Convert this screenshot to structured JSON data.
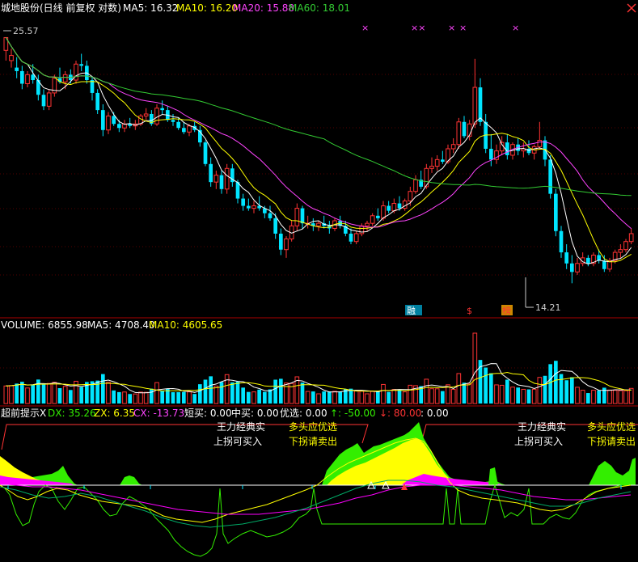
{
  "colors": {
    "up": "#ff3333",
    "down": "#00e5ff",
    "ma5": "#ffffff",
    "ma10": "#ffff00",
    "ma20": "#ff44ff",
    "ma60": "#33cc33",
    "red_line": "#aa0000",
    "label_white": "#ffffff",
    "label_gray": "#c0c0c0",
    "yellow_fill": "#ffff00",
    "green_fill": "#33ee00",
    "magenta_fill": "#ff00ff"
  },
  "header": {
    "stock_title": "城地股份(日线 前复权 对数)",
    "ma5_label": "MA5: 16.32",
    "ma10_label": "MA10: 16.20",
    "ma20_label": "MA20: 15.88",
    "ma60_label": "MA60: 18.01"
  },
  "price_pane": {
    "high_label": "25.57",
    "low_label": "14.21",
    "markers": [
      "×",
      "××",
      "×",
      "×",
      "×"
    ],
    "tags": [
      "融",
      "$",
      "榜"
    ]
  },
  "volume_pane": {
    "volume_label": "VOLUME: 6855.98",
    "ma5_label": "MA5: 4708.40",
    "ma10_label": "MA10: 4605.65"
  },
  "indicator_pane": {
    "name": "超前提示X",
    "dx": "DX: 35.26",
    "zx": "ZX: 6.35",
    "cx": "CX: -13.73",
    "short_buy": "短买: 0.00",
    "mid_buy": "中买: 0.00",
    "select": "优选: 0.00",
    "up_arrow": "↑: -50.00",
    "down_arrow": "↓: 80.00",
    "colon_val": ": 0.00",
    "left_labels": {
      "main_force": "王力经典实",
      "turn_buy": "上拐可买入",
      "bull": "多头应优选",
      "turn_sell": "下拐请卖出"
    },
    "right_labels": {
      "main_force": "王力经典实",
      "turn_buy": "上拐可买入",
      "bull": "多头应优选",
      "turn_sell": "下拐请卖出"
    }
  },
  "chart_data": {
    "type": "candlestick",
    "title": "城地股份(日线 前复权 对数)",
    "price_range": [
      14.0,
      26.5
    ],
    "candles": [
      [
        24.8,
        25.3,
        24.2,
        25.57
      ],
      [
        24.2,
        24.9,
        23.8,
        24.5
      ],
      [
        23.8,
        24.4,
        23.2,
        23.6
      ],
      [
        23.6,
        23.9,
        22.6,
        22.9
      ],
      [
        22.9,
        23.6,
        22.7,
        23.4
      ],
      [
        23.4,
        24.0,
        22.9,
        23.1
      ],
      [
        23.1,
        23.4,
        22.0,
        22.3
      ],
      [
        22.3,
        22.6,
        21.5,
        21.7
      ],
      [
        21.7,
        22.6,
        21.5,
        22.4
      ],
      [
        22.4,
        23.4,
        22.2,
        23.2
      ],
      [
        23.2,
        23.8,
        22.9,
        23.0
      ],
      [
        23.0,
        23.6,
        22.6,
        23.4
      ],
      [
        23.4,
        23.7,
        22.9,
        23.1
      ],
      [
        23.1,
        24.2,
        22.9,
        24.0
      ],
      [
        24.0,
        24.6,
        23.6,
        23.9
      ],
      [
        23.9,
        24.2,
        22.9,
        23.1
      ],
      [
        23.1,
        23.3,
        22.0,
        22.4
      ],
      [
        22.4,
        22.6,
        21.3,
        21.5
      ],
      [
        21.5,
        21.8,
        20.2,
        20.5
      ],
      [
        20.5,
        21.4,
        20.3,
        21.2
      ],
      [
        21.2,
        21.4,
        20.7,
        20.8
      ],
      [
        20.8,
        21.0,
        20.4,
        20.6
      ],
      [
        20.6,
        21.0,
        20.4,
        20.8
      ],
      [
        20.8,
        21.1,
        20.6,
        20.7
      ],
      [
        20.7,
        21.0,
        20.5,
        20.8
      ],
      [
        20.8,
        21.3,
        20.7,
        21.2
      ],
      [
        21.2,
        21.6,
        21.0,
        21.3
      ],
      [
        21.3,
        21.5,
        20.7,
        20.8
      ],
      [
        20.8,
        21.8,
        20.7,
        21.6
      ],
      [
        21.6,
        22.0,
        21.3,
        21.5
      ],
      [
        21.5,
        21.7,
        20.9,
        21.0
      ],
      [
        21.0,
        21.3,
        20.7,
        20.9
      ],
      [
        20.9,
        21.1,
        20.5,
        20.6
      ],
      [
        20.6,
        20.9,
        20.3,
        20.4
      ],
      [
        20.4,
        20.8,
        20.2,
        20.7
      ],
      [
        20.7,
        20.9,
        20.4,
        20.5
      ],
      [
        20.5,
        20.7,
        19.7,
        19.9
      ],
      [
        19.9,
        20.0,
        18.8,
        18.9
      ],
      [
        18.9,
        19.2,
        17.9,
        18.1
      ],
      [
        18.1,
        18.6,
        17.8,
        18.4
      ],
      [
        18.4,
        18.6,
        17.6,
        17.8
      ],
      [
        17.8,
        18.9,
        17.6,
        18.7
      ],
      [
        18.7,
        18.9,
        17.9,
        18.1
      ],
      [
        18.1,
        18.2,
        17.2,
        17.4
      ],
      [
        17.4,
        17.6,
        16.9,
        17.1
      ],
      [
        17.1,
        17.4,
        16.9,
        17.0
      ],
      [
        17.0,
        17.3,
        16.8,
        17.1
      ],
      [
        17.1,
        17.5,
        16.9,
        17.0
      ],
      [
        17.0,
        17.1,
        16.6,
        16.8
      ],
      [
        16.8,
        17.1,
        16.5,
        16.6
      ],
      [
        16.6,
        16.8,
        15.8,
        16.0
      ],
      [
        16.0,
        16.2,
        15.2,
        15.4
      ],
      [
        15.4,
        15.9,
        15.1,
        15.8
      ],
      [
        15.8,
        16.5,
        15.7,
        16.3
      ],
      [
        16.3,
        17.2,
        16.1,
        17.0
      ],
      [
        17.0,
        17.1,
        16.2,
        16.4
      ],
      [
        16.4,
        16.7,
        16.2,
        16.4
      ],
      [
        16.4,
        16.6,
        16.1,
        16.3
      ],
      [
        16.3,
        16.5,
        16.1,
        16.4
      ],
      [
        16.4,
        16.7,
        16.2,
        16.3
      ],
      [
        16.3,
        16.5,
        16.0,
        16.2
      ],
      [
        16.2,
        16.6,
        16.1,
        16.5
      ],
      [
        16.5,
        16.7,
        16.2,
        16.3
      ],
      [
        16.3,
        16.5,
        15.9,
        16.0
      ],
      [
        16.0,
        16.2,
        15.6,
        15.7
      ],
      [
        15.7,
        16.1,
        15.6,
        16.0
      ],
      [
        16.0,
        16.4,
        15.9,
        16.3
      ],
      [
        16.3,
        16.5,
        16.1,
        16.4
      ],
      [
        16.4,
        16.8,
        16.3,
        16.7
      ],
      [
        16.7,
        17.0,
        16.5,
        16.6
      ],
      [
        16.6,
        17.3,
        16.5,
        17.1
      ],
      [
        17.1,
        17.3,
        16.8,
        16.9
      ],
      [
        16.9,
        17.4,
        16.8,
        17.2
      ],
      [
        17.2,
        17.5,
        16.9,
        17.0
      ],
      [
        17.0,
        17.4,
        16.9,
        17.3
      ],
      [
        17.3,
        17.9,
        17.1,
        17.7
      ],
      [
        17.7,
        18.4,
        17.6,
        18.2
      ],
      [
        18.2,
        18.6,
        17.8,
        17.9
      ],
      [
        17.9,
        18.9,
        17.8,
        18.7
      ],
      [
        18.7,
        19.2,
        18.5,
        18.8
      ],
      [
        18.8,
        19.3,
        18.6,
        19.1
      ],
      [
        19.1,
        19.5,
        18.9,
        19.0
      ],
      [
        19.0,
        19.8,
        18.9,
        19.6
      ],
      [
        19.6,
        20.1,
        19.4,
        19.8
      ],
      [
        19.8,
        21.1,
        19.6,
        20.9
      ],
      [
        20.9,
        21.2,
        20.1,
        20.2
      ],
      [
        20.2,
        21.0,
        20.0,
        20.8
      ],
      [
        20.8,
        24.3,
        20.6,
        22.7
      ],
      [
        22.7,
        23.2,
        20.7,
        20.9
      ],
      [
        20.9,
        21.3,
        19.4,
        19.6
      ],
      [
        19.6,
        20.3,
        18.8,
        19.1
      ],
      [
        19.1,
        19.8,
        18.9,
        19.5
      ],
      [
        19.5,
        20.2,
        19.3,
        19.9
      ],
      [
        19.9,
        20.3,
        19.1,
        19.3
      ],
      [
        19.3,
        19.9,
        19.1,
        19.8
      ],
      [
        19.8,
        20.1,
        19.3,
        19.5
      ],
      [
        19.5,
        19.9,
        19.2,
        19.6
      ],
      [
        19.6,
        20.0,
        19.3,
        19.4
      ],
      [
        19.4,
        19.8,
        19.1,
        19.7
      ],
      [
        19.7,
        20.9,
        19.6,
        20.0
      ],
      [
        20.0,
        20.2,
        18.8,
        19.1
      ],
      [
        19.1,
        19.3,
        17.4,
        17.6
      ],
      [
        17.6,
        17.8,
        15.9,
        16.1
      ],
      [
        16.1,
        16.3,
        15.1,
        15.3
      ],
      [
        15.3,
        15.6,
        14.7,
        14.9
      ],
      [
        14.9,
        15.2,
        14.21,
        14.6
      ],
      [
        14.6,
        15.1,
        14.5,
        14.9
      ],
      [
        14.9,
        15.3,
        14.8,
        15.1
      ],
      [
        15.1,
        15.2,
        14.8,
        14.9
      ],
      [
        14.9,
        15.3,
        14.8,
        15.2
      ],
      [
        15.2,
        15.4,
        14.9,
        15.0
      ],
      [
        15.0,
        15.2,
        14.6,
        14.7
      ],
      [
        14.7,
        15.1,
        14.6,
        15.0
      ],
      [
        15.0,
        15.4,
        14.9,
        15.3
      ],
      [
        15.3,
        15.6,
        15.1,
        15.4
      ],
      [
        15.4,
        15.8,
        15.3,
        15.7
      ],
      [
        15.7,
        16.2,
        15.6,
        16.0
      ]
    ]
  }
}
